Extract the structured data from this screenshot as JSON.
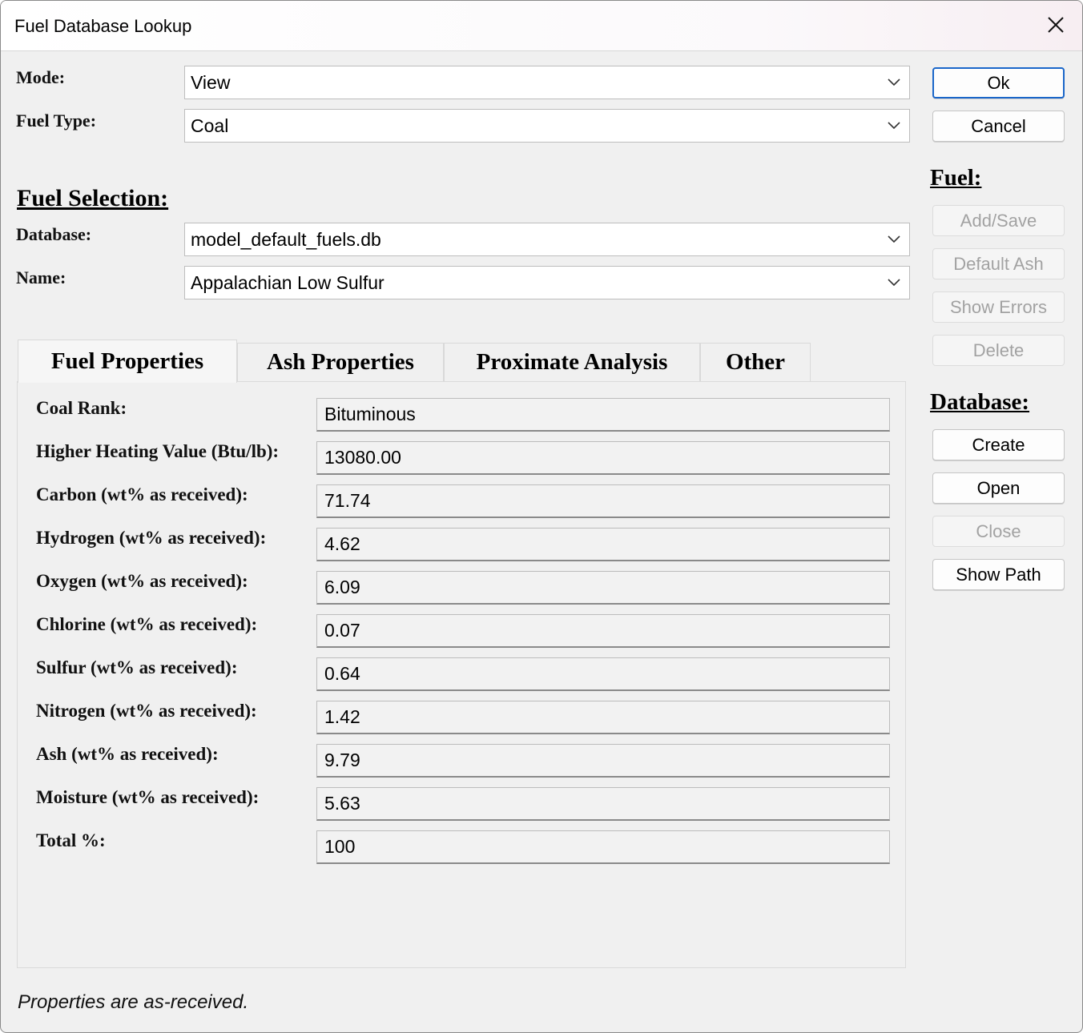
{
  "window": {
    "title": "Fuel Database Lookup"
  },
  "top": {
    "mode_label": "Mode:",
    "mode_value": "View",
    "fuel_type_label": "Fuel Type:",
    "fuel_type_value": "Coal"
  },
  "selection": {
    "heading": "Fuel Selection:",
    "database_label": "Database:",
    "database_value": "model_default_fuels.db",
    "name_label": "Name:",
    "name_value": "Appalachian Low Sulfur"
  },
  "buttons": {
    "ok": "Ok",
    "cancel": "Cancel",
    "fuel_heading": "Fuel:",
    "add_save": "Add/Save",
    "default_ash": "Default Ash",
    "show_errors": "Show Errors",
    "delete": "Delete",
    "database_heading": "Database:",
    "create": "Create",
    "open": "Open",
    "close": "Close",
    "show_path": "Show Path"
  },
  "tabs": [
    {
      "label": "Fuel Properties",
      "active": true
    },
    {
      "label": "Ash Properties",
      "active": false
    },
    {
      "label": "Proximate Analysis",
      "active": false
    },
    {
      "label": "Other",
      "active": false
    }
  ],
  "properties": [
    {
      "label": "Coal Rank:",
      "value": "Bituminous"
    },
    {
      "label": "Higher Heating Value (Btu/lb):",
      "value": "13080.00"
    },
    {
      "label": "Carbon (wt% as received):",
      "value": "71.74"
    },
    {
      "label": "Hydrogen (wt% as received):",
      "value": "4.62"
    },
    {
      "label": "Oxygen (wt% as received):",
      "value": "6.09"
    },
    {
      "label": "Chlorine (wt% as received):",
      "value": "0.07"
    },
    {
      "label": "Sulfur (wt% as received):",
      "value": "0.64"
    },
    {
      "label": "Nitrogen (wt% as received):",
      "value": "1.42"
    },
    {
      "label": "Ash (wt% as received):",
      "value": "9.79"
    },
    {
      "label": "Moisture (wt% as received):",
      "value": "5.63"
    },
    {
      "label": "Total %:",
      "value": "100"
    }
  ],
  "status": {
    "text": "Properties are as-received."
  }
}
